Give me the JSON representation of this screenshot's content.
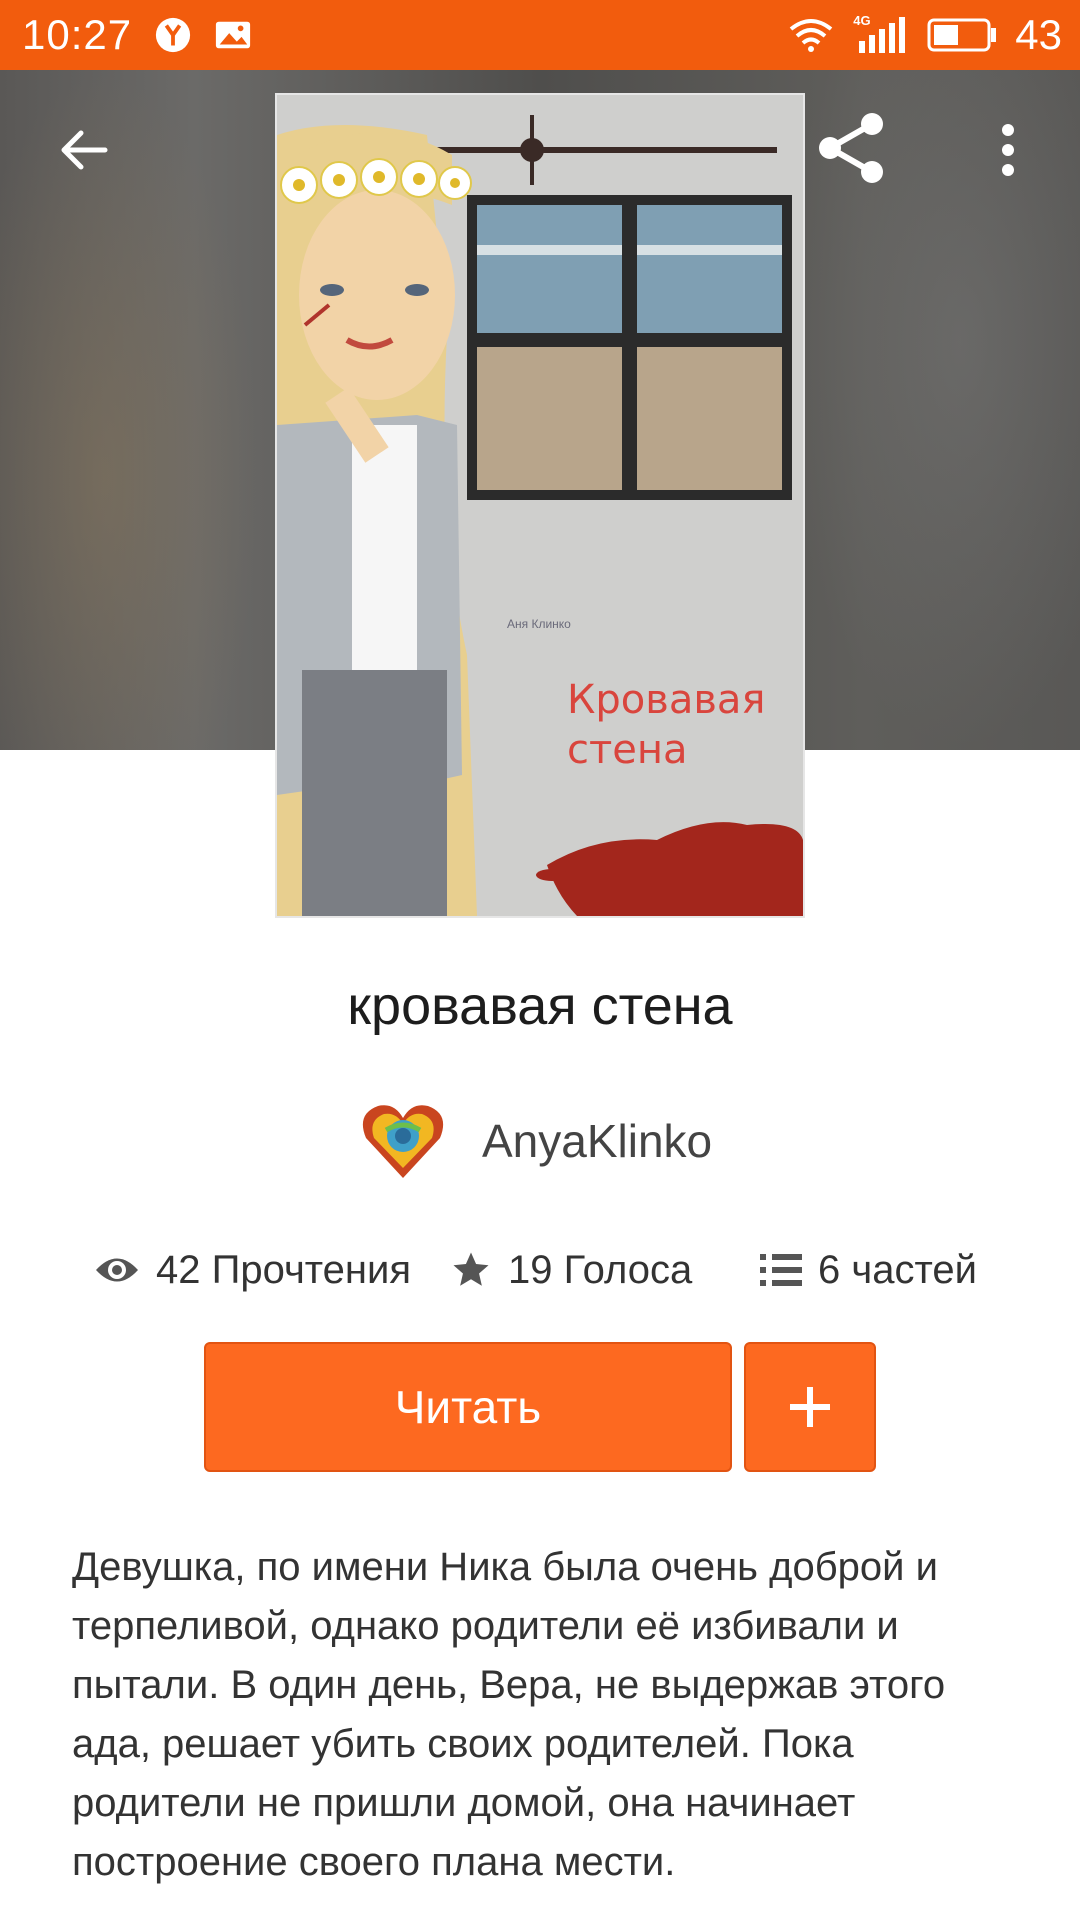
{
  "status_bar": {
    "time": "10:27",
    "network": "4G",
    "battery": "43",
    "icons": [
      "yandex-browser-icon",
      "image-notification-icon",
      "wifi-icon",
      "signal-icon",
      "battery-icon"
    ]
  },
  "toolbar": {
    "back_icon": "arrow-left-icon",
    "share_icon": "share-icon",
    "more_icon": "more-vert-icon"
  },
  "cover": {
    "author": "Аня Клинко",
    "title_line1": "Кровавая",
    "title_line2": "стена"
  },
  "book": {
    "title": "кровавая стена",
    "author": "AnyaKlinko"
  },
  "stats": {
    "reads": "42 Прочтения",
    "votes": "19 Голоса",
    "parts": "6 частей"
  },
  "actions": {
    "read_label": "Читать",
    "add_label": "+"
  },
  "description": "Девушка, по имени Ника была очень доброй и терпеливой, однако родители её избивали и пытали. В один день, Вера, не выдержав этого ада, решает убить своих родителей. Пока родители не пришли домой, она начинает построение своего плана мести.",
  "colors": {
    "accent": "#fd6920",
    "status_bar": "#f25c0d",
    "header_bg": "#5a5856"
  }
}
